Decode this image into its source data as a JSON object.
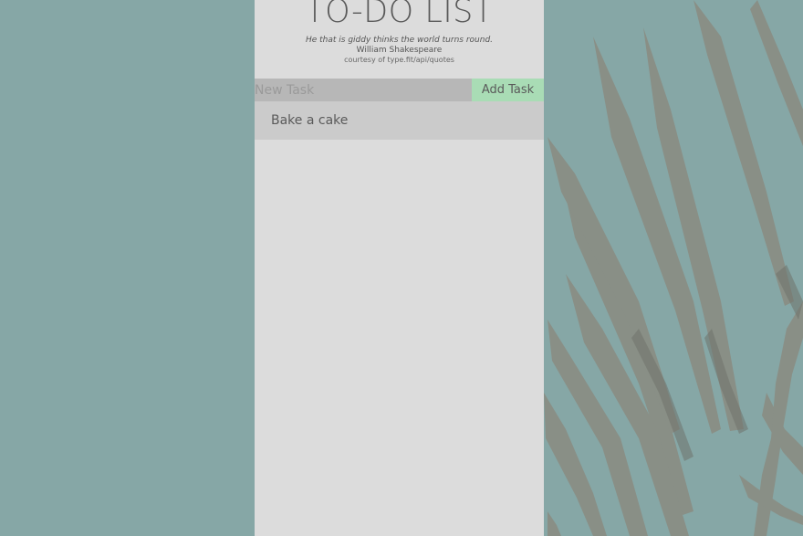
{
  "header": {
    "title": "TO-DO LIST",
    "quote": "He that is giddy thinks the world turns round.",
    "author": "William Shakespeare",
    "credit": "courtesy of type.fit/api/quotes"
  },
  "form": {
    "input_placeholder": "New Task",
    "input_value": "",
    "add_button_label": "Add Task"
  },
  "tasks": [
    {
      "label": "Bake a cake"
    }
  ],
  "colors": {
    "background": "#86a7a6",
    "panel": "#dcdcdc",
    "input": "#b7b7b7",
    "add_button": "#a9dcb5",
    "task_item": "#cbcbcb"
  },
  "icons": {
    "background_decoration": "palm-leaves-image"
  }
}
